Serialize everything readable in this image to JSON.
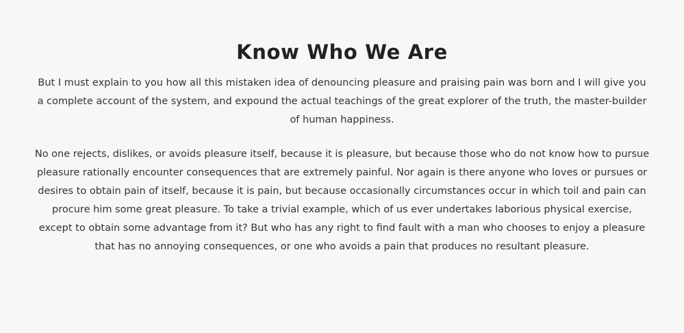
{
  "section": {
    "title": "Know Who We Are",
    "paragraphs": [
      "But I must explain to you how all this mistaken idea of denouncing pleasure and praising pain was born and I will give you a complete account of the system, and expound the actual teachings of the great explorer of the truth, the master-builder of human happiness.",
      "No one rejects, dislikes, or avoids pleasure itself, because it is pleasure, but because those who do not know how to pursue pleasure rationally encounter consequences that are extremely painful. Nor again is there anyone who loves or pursues or desires to obtain pain of itself, because it is pain, but because occasionally circumstances occur in which toil and pain can procure him some great pleasure. To take a trivial example, which of us ever undertakes laborious physical exercise, except to obtain some advantage from it? But who has any right to find fault with a man who chooses to enjoy a pleasure that has no annoying consequences, or one who avoids a pain that produces no resultant pleasure."
    ]
  },
  "colors": {
    "background": "#f7f7f7",
    "heading": "#222222",
    "text": "#333333"
  }
}
